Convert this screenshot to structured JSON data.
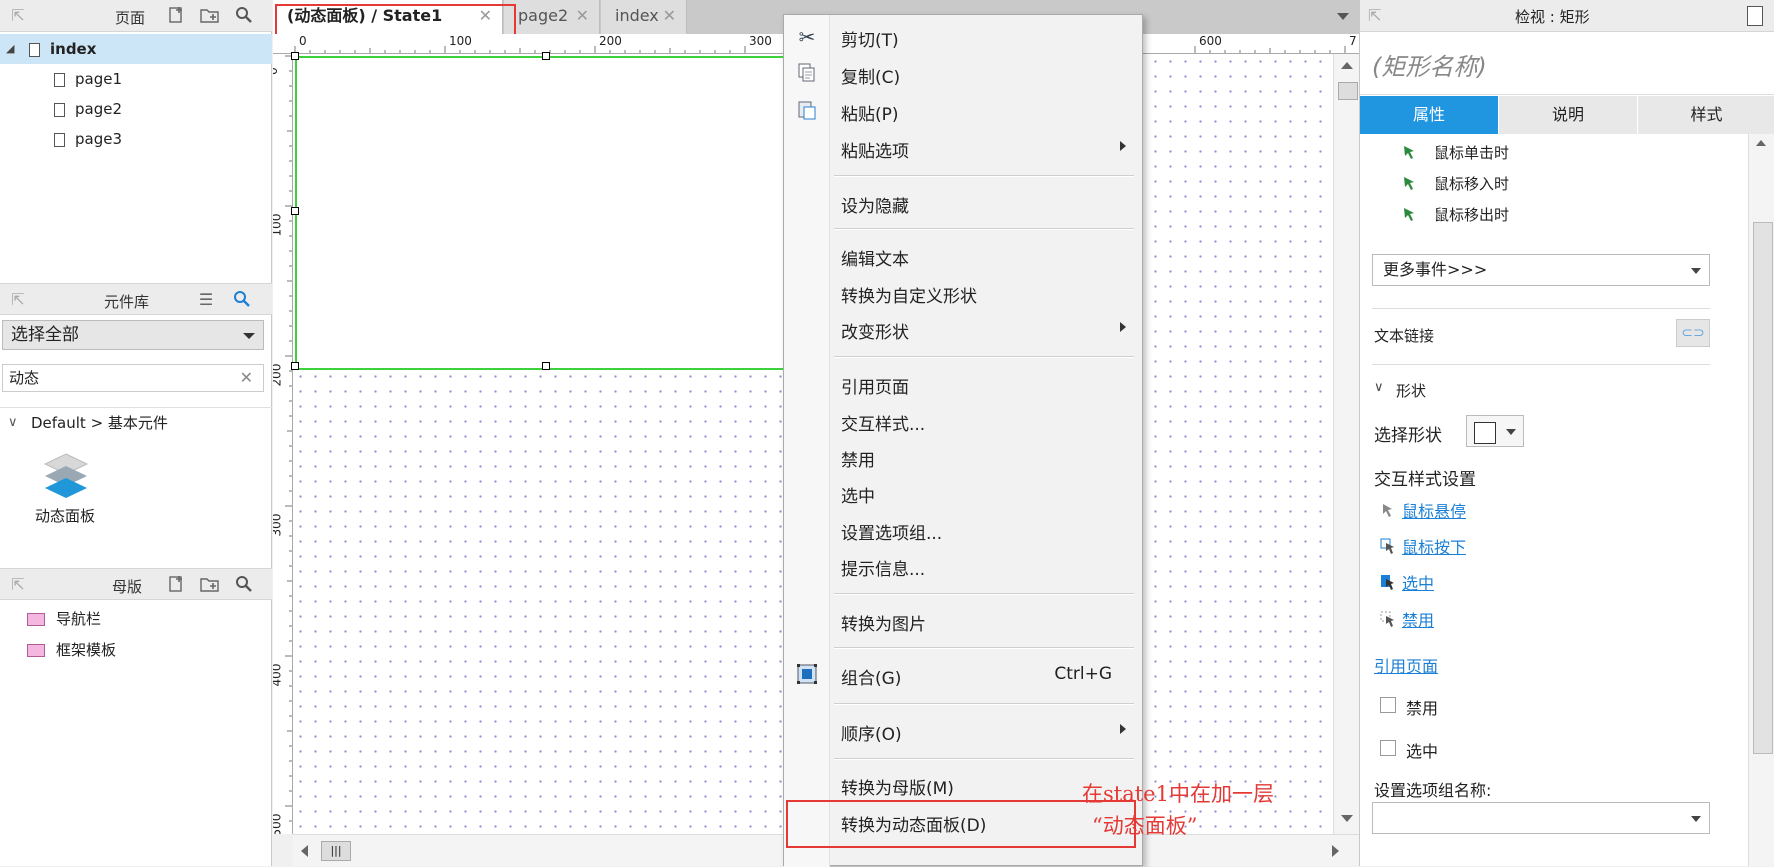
{
  "pages_panel": {
    "title": "页面",
    "items": [
      {
        "label": "index"
      },
      {
        "label": "page1"
      },
      {
        "label": "page2"
      },
      {
        "label": "page3"
      }
    ]
  },
  "library_panel": {
    "title": "元件库",
    "select_value": "选择全部",
    "search_value": "动态",
    "group_label": "Default > 基本元件",
    "widget_label": "动态面板"
  },
  "masters_panel": {
    "title": "母版",
    "items": [
      {
        "label": "导航栏"
      },
      {
        "label": "框架模板"
      }
    ]
  },
  "tabs": [
    {
      "label": "(动态面板) / State1 (index)",
      "active": true
    },
    {
      "label": "page2"
    },
    {
      "label": "index"
    }
  ],
  "ruler_top": [
    "0",
    "100",
    "200",
    "300",
    "600",
    "7"
  ],
  "ruler_left": [
    "0",
    "100",
    "200",
    "300",
    "400",
    "500"
  ],
  "context_menu": {
    "items": [
      {
        "label": "剪切(T)",
        "icon": "scissors-icon"
      },
      {
        "label": "复制(C)",
        "icon": "copy-icon"
      },
      {
        "label": "粘贴(P)",
        "icon": "paste-icon"
      },
      {
        "label": "粘贴选项",
        "submenu": true
      },
      {
        "label": "设为隐藏"
      },
      {
        "label": "编辑文本"
      },
      {
        "label": "转换为自定义形状"
      },
      {
        "label": "改变形状",
        "submenu": true
      },
      {
        "label": "引用页面"
      },
      {
        "label": "交互样式..."
      },
      {
        "label": "禁用"
      },
      {
        "label": "选中"
      },
      {
        "label": "设置选项组..."
      },
      {
        "label": "提示信息..."
      },
      {
        "label": "转换为图片"
      },
      {
        "label": "组合(G)",
        "shortcut": "Ctrl+G",
        "icon": "group-icon"
      },
      {
        "label": "顺序(O)",
        "submenu": true
      },
      {
        "label": "转换为母版(M)"
      },
      {
        "label": "转换为动态面板(D)"
      }
    ]
  },
  "annotation": {
    "line1": "在state1中在加一层",
    "line2": "“动态面板”",
    "color": "#e53935"
  },
  "inspector": {
    "header": "检视 : 矩形",
    "name_placeholder": "(矩形名称)",
    "tabs": [
      "属性",
      "说明",
      "样式"
    ],
    "events": [
      "鼠标单击时",
      "鼠标移入时",
      "鼠标移出时"
    ],
    "more_events": "更多事件>>>",
    "text_link": "文本链接",
    "shape_section": "形状",
    "select_shape": "选择形状",
    "interaction_styles": "交互样式设置",
    "style_links": [
      "鼠标悬停",
      "鼠标按下",
      "选中",
      "禁用"
    ],
    "ref_page": "引用页面",
    "disabled": "禁用",
    "selected": "选中",
    "option_group": "设置选项组名称:"
  },
  "colors": {
    "accent": "#1a7fd6",
    "tab_active_bg": "#2196e0",
    "selection_border": "#3dd23d",
    "highlight_box": "#e53935"
  }
}
